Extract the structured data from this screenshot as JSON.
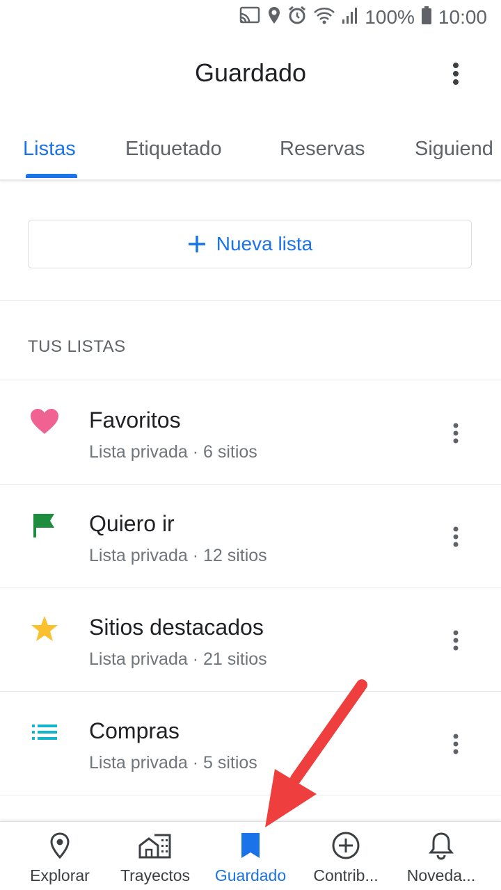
{
  "status_bar": {
    "battery": "100%",
    "time": "10:00"
  },
  "header": {
    "title": "Guardado"
  },
  "tabs": [
    {
      "label": "Listas"
    },
    {
      "label": "Etiquetado"
    },
    {
      "label": "Reservas"
    },
    {
      "label": "Siguiend"
    }
  ],
  "new_list": {
    "label": "Nueva lista"
  },
  "section_title": "TUS LISTAS",
  "lists": [
    {
      "name": "Favoritos",
      "meta": "Lista privada · 6 sitios",
      "icon": "heart-icon",
      "color": "#f06292"
    },
    {
      "name": "Quiero ir",
      "meta": "Lista privada · 12 sitios",
      "icon": "flag-icon",
      "color": "#1e8e3e"
    },
    {
      "name": "Sitios destacados",
      "meta": "Lista privada · 21 sitios",
      "icon": "star-icon",
      "color": "#fbc02d"
    },
    {
      "name": "Compras",
      "meta": "Lista privada · 5 sitios",
      "icon": "list-icon",
      "color": "#12b5cb"
    }
  ],
  "bottom_nav": [
    {
      "label": "Explorar",
      "icon": "pin-icon"
    },
    {
      "label": "Trayectos",
      "icon": "commute-icon"
    },
    {
      "label": "Guardado",
      "icon": "bookmark-icon"
    },
    {
      "label": "Contrib...",
      "icon": "add-circle-icon"
    },
    {
      "label": "Noveda...",
      "icon": "bell-icon"
    }
  ],
  "colors": {
    "accent": "#1a73e8",
    "annotation_arrow": "#ef3e3e"
  }
}
